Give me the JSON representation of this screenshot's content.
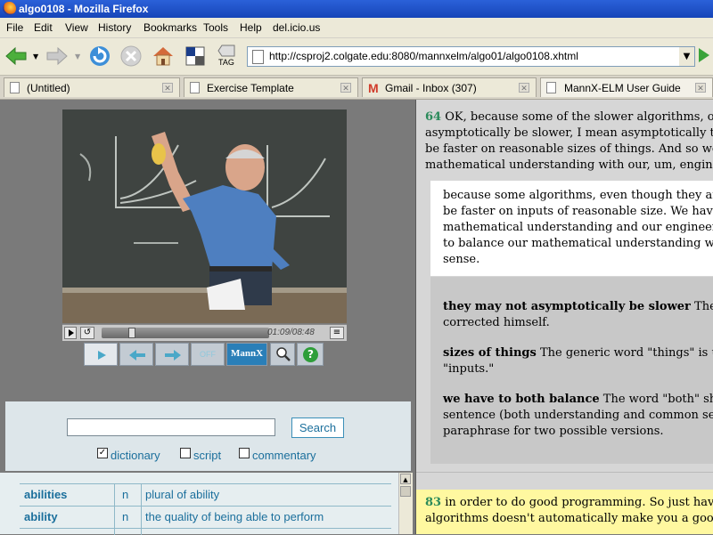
{
  "window": {
    "title": "algo0108 - Mozilla Firefox"
  },
  "menu": [
    "File",
    "Edit",
    "View",
    "History",
    "Bookmarks",
    "Tools",
    "Help",
    "del.icio.us"
  ],
  "toolbar": {
    "tag_label": "TAG",
    "url": "http://csproj2.colgate.edu:8080/mannxelm/algo01/algo0108.xhtml"
  },
  "tabs": [
    {
      "label": "(Untitled)"
    },
    {
      "label": "Exercise Template"
    },
    {
      "label": "Gmail - Inbox (307)"
    },
    {
      "label": "MannX-ELM User Guide"
    }
  ],
  "player": {
    "time": "01:09/08:48",
    "off_label": "OFF",
    "logo_label": "MannX"
  },
  "search": {
    "button": "Search",
    "value": "",
    "options": [
      {
        "label": "dictionary",
        "checked": true
      },
      {
        "label": "script",
        "checked": false
      },
      {
        "label": "commentary",
        "checked": false
      }
    ]
  },
  "dictionary": [
    {
      "word": "abilities",
      "pos": "n",
      "definition": "plural of ability"
    },
    {
      "word": "ability",
      "pos": "n",
      "definition": "the quality of being able to perform"
    }
  ],
  "transcript": {
    "p1_num": "64",
    "p1_lines": [
      "OK, because some of the slower algorithms, o",
      "asymptotically be slower, I mean asymptotically the",
      "be faster on reasonable sizes of things. And so we h",
      "mathematical understanding with our, um, engineer"
    ],
    "paraphrase": [
      "because some algorithms, even though they are s",
      "be faster on inputs of reasonable size. We have t",
      "mathematical understanding and our engineering",
      "to balance our mathematical understanding with",
      "sense."
    ],
    "notes": [
      {
        "term": "they may not asymptotically be slower",
        "lines": [
          " The le",
          "corrected himself."
        ]
      },
      {
        "term": "sizes of things",
        "lines": [
          " The generic word \"things\" is use",
          "\"inputs.\""
        ]
      },
      {
        "term": "we have to both balance",
        "lines": [
          " The word \"both\" sho",
          "sentence (both understanding and common sens",
          "paraphrase for two possible versions."
        ]
      }
    ],
    "p2_num": "83",
    "p2_lines": [
      "in order to do good programming. So just hav",
      "algorithms doesn't automatically make you a good p"
    ]
  },
  "colors": {
    "accent": "#1b6f9c",
    "number": "#2a8a5a",
    "highlight": "#fff8a0"
  }
}
